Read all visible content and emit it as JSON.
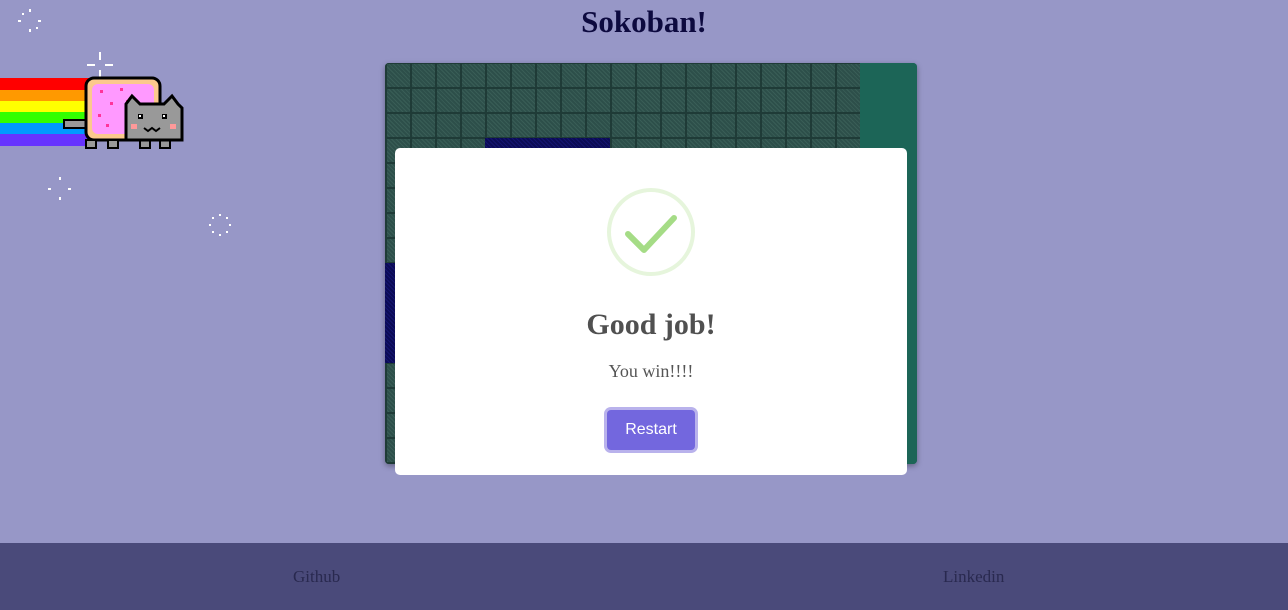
{
  "header": {
    "title": "Sokoban!"
  },
  "modal": {
    "icon": "checkmark-icon",
    "title": "Good job!",
    "text": "You win!!!!",
    "button_label": "Restart"
  },
  "footer": {
    "links": [
      {
        "label": "Github"
      },
      {
        "label": "Linkedin"
      }
    ]
  },
  "colors": {
    "background": "#9797c7",
    "accent": "#7367de",
    "success": "#a5dc86",
    "footer": "#4a4a7a"
  }
}
